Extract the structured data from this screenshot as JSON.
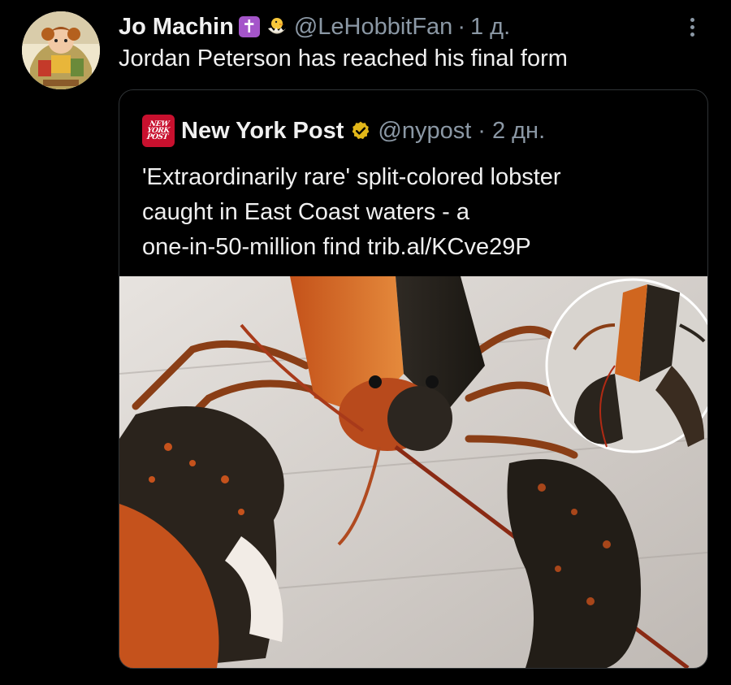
{
  "tweet": {
    "author_name": "Jo Machin",
    "cross_emoji": "✝",
    "handle": "@LeHobbitFan",
    "separator": "·",
    "time": "1 д.",
    "text": "Jordan Peterson has reached his final form"
  },
  "quoted_tweet": {
    "logo_lines": [
      "NEW",
      "YORK",
      "POST"
    ],
    "author_name": "New York Post",
    "handle": "@nypost",
    "separator": "·",
    "time": "2 дн.",
    "text_lines": [
      "'Extraordinarily rare' split-colored lobster",
      "caught in East Coast waters - a",
      "one-in-50-million find trib.al/KCve29P"
    ]
  },
  "icons": {
    "more": "more-vertical-icon",
    "verified": "verified-gold-badge-icon",
    "chick": "hatching-chick-icon",
    "cross": "latin-cross-icon"
  },
  "colors": {
    "background": "#000000",
    "text": "#e7e9ea",
    "secondary": "#8b98a5",
    "border": "#2f3336",
    "nyp_red": "#c8102e",
    "verified_gold": "#e2b719",
    "cross_purple": "#a455c9"
  }
}
